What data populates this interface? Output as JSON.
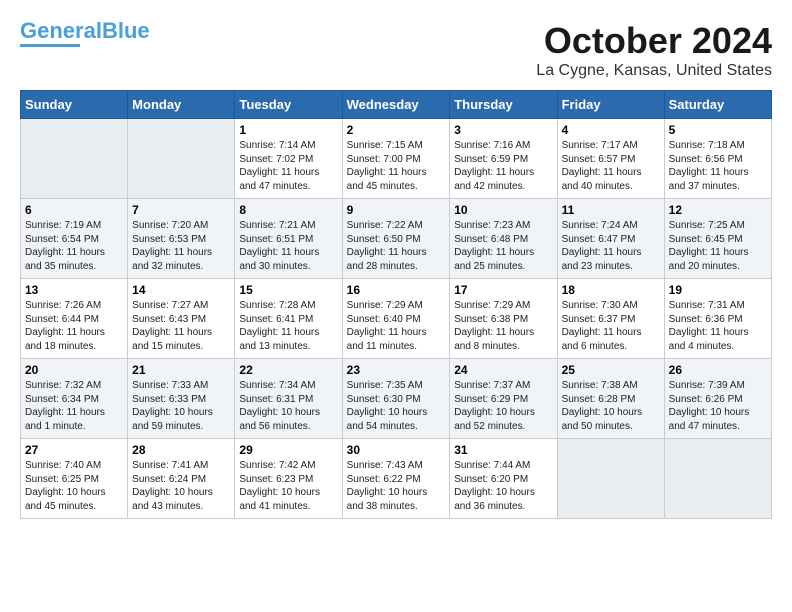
{
  "header": {
    "logo_line1": "General",
    "logo_line2": "Blue",
    "month_title": "October 2024",
    "location": "La Cygne, Kansas, United States"
  },
  "weekdays": [
    "Sunday",
    "Monday",
    "Tuesday",
    "Wednesday",
    "Thursday",
    "Friday",
    "Saturday"
  ],
  "weeks": [
    [
      {
        "day": "",
        "info": ""
      },
      {
        "day": "",
        "info": ""
      },
      {
        "day": "1",
        "info": "Sunrise: 7:14 AM\nSunset: 7:02 PM\nDaylight: 11 hours and 47 minutes."
      },
      {
        "day": "2",
        "info": "Sunrise: 7:15 AM\nSunset: 7:00 PM\nDaylight: 11 hours and 45 minutes."
      },
      {
        "day": "3",
        "info": "Sunrise: 7:16 AM\nSunset: 6:59 PM\nDaylight: 11 hours and 42 minutes."
      },
      {
        "day": "4",
        "info": "Sunrise: 7:17 AM\nSunset: 6:57 PM\nDaylight: 11 hours and 40 minutes."
      },
      {
        "day": "5",
        "info": "Sunrise: 7:18 AM\nSunset: 6:56 PM\nDaylight: 11 hours and 37 minutes."
      }
    ],
    [
      {
        "day": "6",
        "info": "Sunrise: 7:19 AM\nSunset: 6:54 PM\nDaylight: 11 hours and 35 minutes."
      },
      {
        "day": "7",
        "info": "Sunrise: 7:20 AM\nSunset: 6:53 PM\nDaylight: 11 hours and 32 minutes."
      },
      {
        "day": "8",
        "info": "Sunrise: 7:21 AM\nSunset: 6:51 PM\nDaylight: 11 hours and 30 minutes."
      },
      {
        "day": "9",
        "info": "Sunrise: 7:22 AM\nSunset: 6:50 PM\nDaylight: 11 hours and 28 minutes."
      },
      {
        "day": "10",
        "info": "Sunrise: 7:23 AM\nSunset: 6:48 PM\nDaylight: 11 hours and 25 minutes."
      },
      {
        "day": "11",
        "info": "Sunrise: 7:24 AM\nSunset: 6:47 PM\nDaylight: 11 hours and 23 minutes."
      },
      {
        "day": "12",
        "info": "Sunrise: 7:25 AM\nSunset: 6:45 PM\nDaylight: 11 hours and 20 minutes."
      }
    ],
    [
      {
        "day": "13",
        "info": "Sunrise: 7:26 AM\nSunset: 6:44 PM\nDaylight: 11 hours and 18 minutes."
      },
      {
        "day": "14",
        "info": "Sunrise: 7:27 AM\nSunset: 6:43 PM\nDaylight: 11 hours and 15 minutes."
      },
      {
        "day": "15",
        "info": "Sunrise: 7:28 AM\nSunset: 6:41 PM\nDaylight: 11 hours and 13 minutes."
      },
      {
        "day": "16",
        "info": "Sunrise: 7:29 AM\nSunset: 6:40 PM\nDaylight: 11 hours and 11 minutes."
      },
      {
        "day": "17",
        "info": "Sunrise: 7:29 AM\nSunset: 6:38 PM\nDaylight: 11 hours and 8 minutes."
      },
      {
        "day": "18",
        "info": "Sunrise: 7:30 AM\nSunset: 6:37 PM\nDaylight: 11 hours and 6 minutes."
      },
      {
        "day": "19",
        "info": "Sunrise: 7:31 AM\nSunset: 6:36 PM\nDaylight: 11 hours and 4 minutes."
      }
    ],
    [
      {
        "day": "20",
        "info": "Sunrise: 7:32 AM\nSunset: 6:34 PM\nDaylight: 11 hours and 1 minute."
      },
      {
        "day": "21",
        "info": "Sunrise: 7:33 AM\nSunset: 6:33 PM\nDaylight: 10 hours and 59 minutes."
      },
      {
        "day": "22",
        "info": "Sunrise: 7:34 AM\nSunset: 6:31 PM\nDaylight: 10 hours and 56 minutes."
      },
      {
        "day": "23",
        "info": "Sunrise: 7:35 AM\nSunset: 6:30 PM\nDaylight: 10 hours and 54 minutes."
      },
      {
        "day": "24",
        "info": "Sunrise: 7:37 AM\nSunset: 6:29 PM\nDaylight: 10 hours and 52 minutes."
      },
      {
        "day": "25",
        "info": "Sunrise: 7:38 AM\nSunset: 6:28 PM\nDaylight: 10 hours and 50 minutes."
      },
      {
        "day": "26",
        "info": "Sunrise: 7:39 AM\nSunset: 6:26 PM\nDaylight: 10 hours and 47 minutes."
      }
    ],
    [
      {
        "day": "27",
        "info": "Sunrise: 7:40 AM\nSunset: 6:25 PM\nDaylight: 10 hours and 45 minutes."
      },
      {
        "day": "28",
        "info": "Sunrise: 7:41 AM\nSunset: 6:24 PM\nDaylight: 10 hours and 43 minutes."
      },
      {
        "day": "29",
        "info": "Sunrise: 7:42 AM\nSunset: 6:23 PM\nDaylight: 10 hours and 41 minutes."
      },
      {
        "day": "30",
        "info": "Sunrise: 7:43 AM\nSunset: 6:22 PM\nDaylight: 10 hours and 38 minutes."
      },
      {
        "day": "31",
        "info": "Sunrise: 7:44 AM\nSunset: 6:20 PM\nDaylight: 10 hours and 36 minutes."
      },
      {
        "day": "",
        "info": ""
      },
      {
        "day": "",
        "info": ""
      }
    ]
  ]
}
